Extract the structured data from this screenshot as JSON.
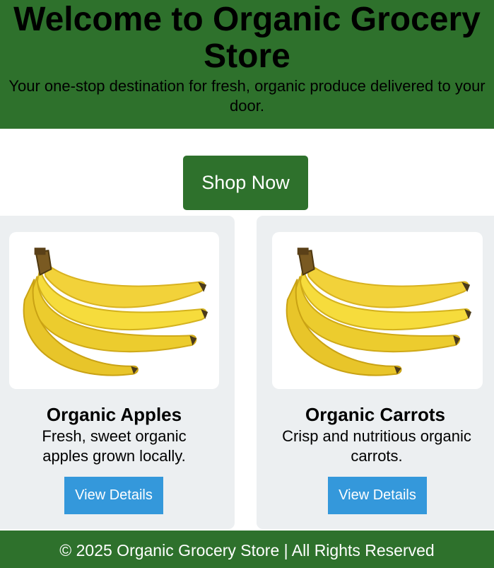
{
  "header": {
    "title": "Welcome to Organic Grocery Store",
    "tagline": "Your one-stop destination for fresh, organic produce delivered to your door."
  },
  "hero": {
    "shop_now_label": "Shop Now"
  },
  "products": [
    {
      "name": "Organic Apples",
      "description": "Fresh, sweet organic apples grown locally.",
      "button_label": "View Details",
      "image_icon": "banana-bunch-image"
    },
    {
      "name": "Organic Carrots",
      "description": "Crisp and nutritious organic carrots.",
      "button_label": "View Details",
      "image_icon": "banana-bunch-image"
    }
  ],
  "footer": {
    "text": "© 2025 Organic Grocery Store | All Rights Reserved"
  },
  "colors": {
    "brand_green": "#2e712c",
    "button_blue": "#3498db",
    "card_background": "#eceff1"
  }
}
